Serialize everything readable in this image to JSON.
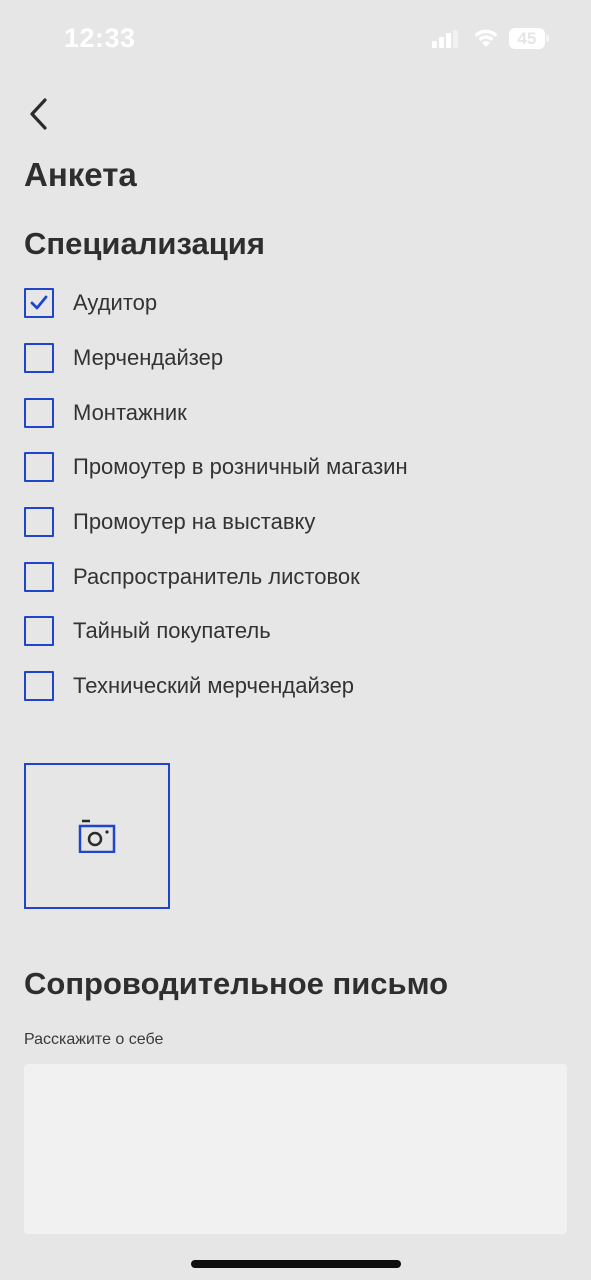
{
  "status_bar": {
    "time": "12:33",
    "battery_level": "45",
    "icons": [
      "signal-icon",
      "wifi-icon",
      "battery-icon"
    ]
  },
  "header": {
    "back_icon": "chevron-left-icon",
    "title": "Анкета"
  },
  "specialization": {
    "title": "Специализация",
    "options": [
      {
        "label": "Аудитор",
        "checked": true
      },
      {
        "label": "Мерчендайзер",
        "checked": false
      },
      {
        "label": "Монтажник",
        "checked": false
      },
      {
        "label": "Промоутер в розничный магазин",
        "checked": false
      },
      {
        "label": "Промоутер на выставку",
        "checked": false
      },
      {
        "label": "Распространитель листовок",
        "checked": false
      },
      {
        "label": "Тайный покупатель",
        "checked": false
      },
      {
        "label": "Технический мерчендайзер",
        "checked": false
      }
    ]
  },
  "photo_upload": {
    "icon": "camera-icon"
  },
  "cover_letter": {
    "title": "Сопроводительное письмо",
    "label": "Расскажите о себе",
    "value": ""
  },
  "colors": {
    "accent": "#1f45c9",
    "background": "#e6e6e6",
    "textarea_bg": "#f1f1f1",
    "text": "#2e2e2e"
  }
}
